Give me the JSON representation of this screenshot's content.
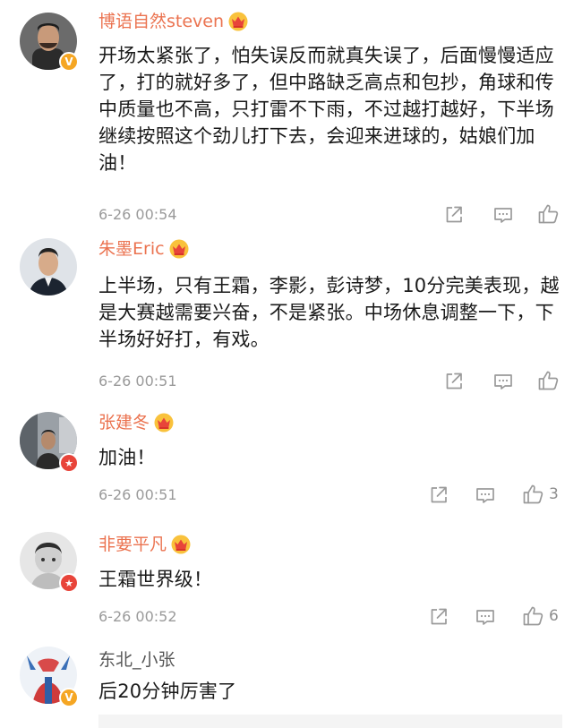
{
  "comments": [
    {
      "name": "博语自然steven",
      "text": "开场太紧张了，怕失误反而就真失误了，后面慢慢适应了，打的就好多了，但中路缺乏高点和包抄，角球和传中质量也不高，只打雷不下雨，不过越打越好，下半场继续按照这个劲儿打下去，会迎来进球的，姑娘们加油！",
      "time": "6-26 00:54",
      "likes": "",
      "badge": "V",
      "badge_color": "gold"
    },
    {
      "name": "朱墨Eric",
      "text": "上半场，只有王霜，李影，彭诗梦，10分完美表现，越是大赛越需要兴奋，不是紧张。中场休息调整一下，下半场好好打，有戏。",
      "time": "6-26 00:51",
      "likes": "",
      "badge": "",
      "badge_color": ""
    },
    {
      "name": "张建冬",
      "text": "加油！",
      "time": "6-26 00:51",
      "likes": "3",
      "badge": "★",
      "badge_color": "red"
    },
    {
      "name": "非要平凡",
      "text": "王霜世界级！",
      "time": "6-26 00:52",
      "likes": "6",
      "badge": "★",
      "badge_color": "red"
    },
    {
      "name": "东北_小张",
      "text": "后20分钟厉害了",
      "time": "",
      "likes": "",
      "badge": "V",
      "badge_color": "gold"
    }
  ],
  "icons": {
    "share": "share-icon",
    "comment": "comment-icon",
    "like": "thumbs-up-icon",
    "membership": "crown-icon"
  },
  "colors": {
    "username": "#eb7350",
    "username_plain": "#555555",
    "gold_badge": "#f5a623",
    "red_badge": "#e8443a",
    "meta_gray": "#9a9a9a"
  }
}
